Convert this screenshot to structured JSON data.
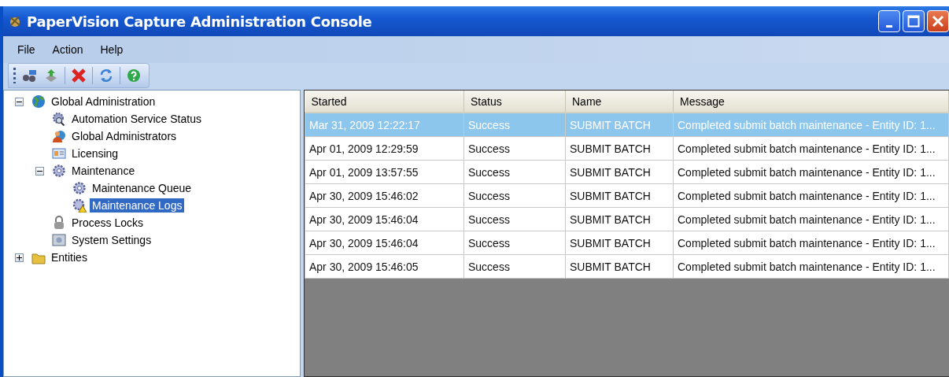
{
  "window": {
    "title": "PaperVision Capture Administration Console"
  },
  "menu": [
    "File",
    "Action",
    "Help"
  ],
  "tree": [
    {
      "label": "Global Administration",
      "kind": "globe",
      "selected": false,
      "expanded": true,
      "children": [
        {
          "label": "Automation Service Status",
          "kind": "gear-search",
          "selected": false
        },
        {
          "label": "Global Administrators",
          "kind": "users",
          "selected": false
        },
        {
          "label": "Licensing",
          "kind": "card",
          "selected": false
        },
        {
          "label": "Maintenance",
          "kind": "gear",
          "selected": false,
          "expanded": true,
          "children": [
            {
              "label": "Maintenance Queue",
              "kind": "gear",
              "selected": false
            },
            {
              "label": "Maintenance Logs",
              "kind": "gear-warning",
              "selected": true
            }
          ]
        },
        {
          "label": "Process Locks",
          "kind": "lock",
          "selected": false
        },
        {
          "label": "System Settings",
          "kind": "settings",
          "selected": false
        }
      ]
    },
    {
      "label": "Entities",
      "kind": "folder",
      "selected": false,
      "expanded": false
    }
  ],
  "table": {
    "columns": [
      "Started",
      "Status",
      "Name",
      "Message"
    ],
    "rows": [
      {
        "cells": [
          "Mar 31, 2009 12:22:17",
          "Success",
          "SUBMIT BATCH",
          "Completed submit batch maintenance - Entity ID: 1..."
        ],
        "selected": true
      },
      {
        "cells": [
          "Apr 01, 2009 12:29:59",
          "Success",
          "SUBMIT BATCH",
          "Completed submit batch maintenance - Entity ID: 1..."
        ],
        "selected": false
      },
      {
        "cells": [
          "Apr 01, 2009 13:57:55",
          "Success",
          "SUBMIT BATCH",
          "Completed submit batch maintenance - Entity ID: 1..."
        ],
        "selected": false
      },
      {
        "cells": [
          "Apr 30, 2009 15:46:02",
          "Success",
          "SUBMIT BATCH",
          "Completed submit batch maintenance - Entity ID: 1..."
        ],
        "selected": false
      },
      {
        "cells": [
          "Apr 30, 2009 15:46:04",
          "Success",
          "SUBMIT BATCH",
          "Completed submit batch maintenance - Entity ID: 1..."
        ],
        "selected": false
      },
      {
        "cells": [
          "Apr 30, 2009 15:46:04",
          "Success",
          "SUBMIT BATCH",
          "Completed submit batch maintenance - Entity ID: 1..."
        ],
        "selected": false
      },
      {
        "cells": [
          "Apr 30, 2009 15:46:05",
          "Success",
          "SUBMIT BATCH",
          "Completed submit batch maintenance - Entity ID: 1..."
        ],
        "selected": false
      }
    ]
  }
}
